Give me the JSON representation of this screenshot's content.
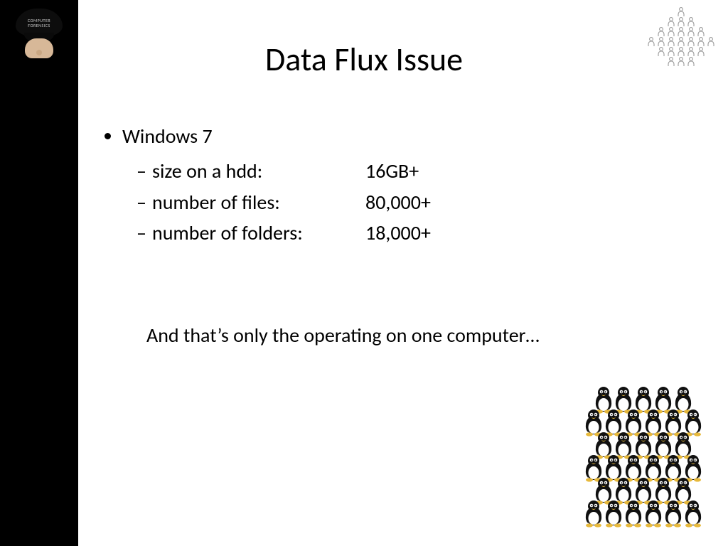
{
  "title": "Data Flux Issue",
  "thumbnail": {
    "cap_line1": "COMPUTER",
    "cap_line2": "FORENSICS"
  },
  "bullets": {
    "os": "Windows 7",
    "items": [
      {
        "label": "size on a hdd:",
        "value": "16GB+"
      },
      {
        "label": "number of files:",
        "value": "80,000+"
      },
      {
        "label": "number of folders:",
        "value": "18,000+"
      }
    ]
  },
  "note": "And that’s only the operating on one computer…"
}
